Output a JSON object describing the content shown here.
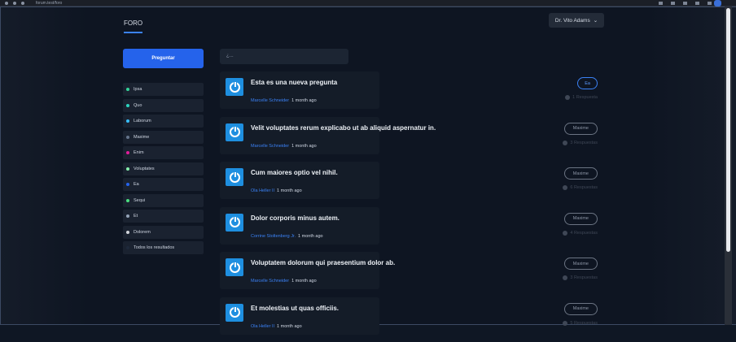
{
  "browser": {
    "url": "forum.test/foro"
  },
  "nav": {
    "tab": "FORO",
    "user": "Dr. Vito Adams",
    "user_chevron": "⌄"
  },
  "ask_button": "Preguntar",
  "search": {
    "placeholder": "¿..."
  },
  "categories": [
    {
      "label": "Ipsa",
      "color": "#34d399"
    },
    {
      "label": "Quo",
      "color": "#2dd4bf"
    },
    {
      "label": "Laborum",
      "color": "#38bdf8"
    },
    {
      "label": "Maxime",
      "color": "#64748b"
    },
    {
      "label": "Enim",
      "color": "#e11d9a"
    },
    {
      "label": "Voluptates",
      "color": "#86efac"
    },
    {
      "label": "Ea",
      "color": "#2563eb"
    },
    {
      "label": "Sequi",
      "color": "#4ade80"
    },
    {
      "label": "Et",
      "color": "#94a3b8"
    },
    {
      "label": "Dolorem",
      "color": "#d1d5db"
    },
    {
      "label": "Todos los resultados",
      "color": "#1e293b"
    }
  ],
  "questions": [
    {
      "title": "Esta es una nueva pregunta",
      "author": "Marcelle Schneider",
      "time": "1 month ago",
      "tag": "Ea",
      "responses": "1 Respuesta"
    },
    {
      "title": "Velit voluptates rerum explicabo ut ab aliquid aspernatur in.",
      "author": "Marcelle Schneider",
      "time": "1 month ago",
      "tag": "Maxime",
      "responses": "3 Respuestas"
    },
    {
      "title": "Cum maiores optio vel nihil.",
      "author": "Ola Heller II",
      "time": "1 month ago",
      "tag": "Maxime",
      "responses": "6 Respuestas"
    },
    {
      "title": "Dolor corporis minus autem.",
      "author": "Corrine Stoltenberg Jr.",
      "time": "1 month ago",
      "tag": "Maxime",
      "responses": "4 Respuestas"
    },
    {
      "title": "Voluptatem dolorum qui praesentium dolor ab.",
      "author": "Marcelle Schneider",
      "time": "1 month ago",
      "tag": "Maxime",
      "responses": "3 Respuestas"
    },
    {
      "title": "Et molestias ut quas officiis.",
      "author": "Ola Heller II",
      "time": "1 month ago",
      "tag": "Maxime",
      "responses": "5 Respuestas"
    }
  ]
}
